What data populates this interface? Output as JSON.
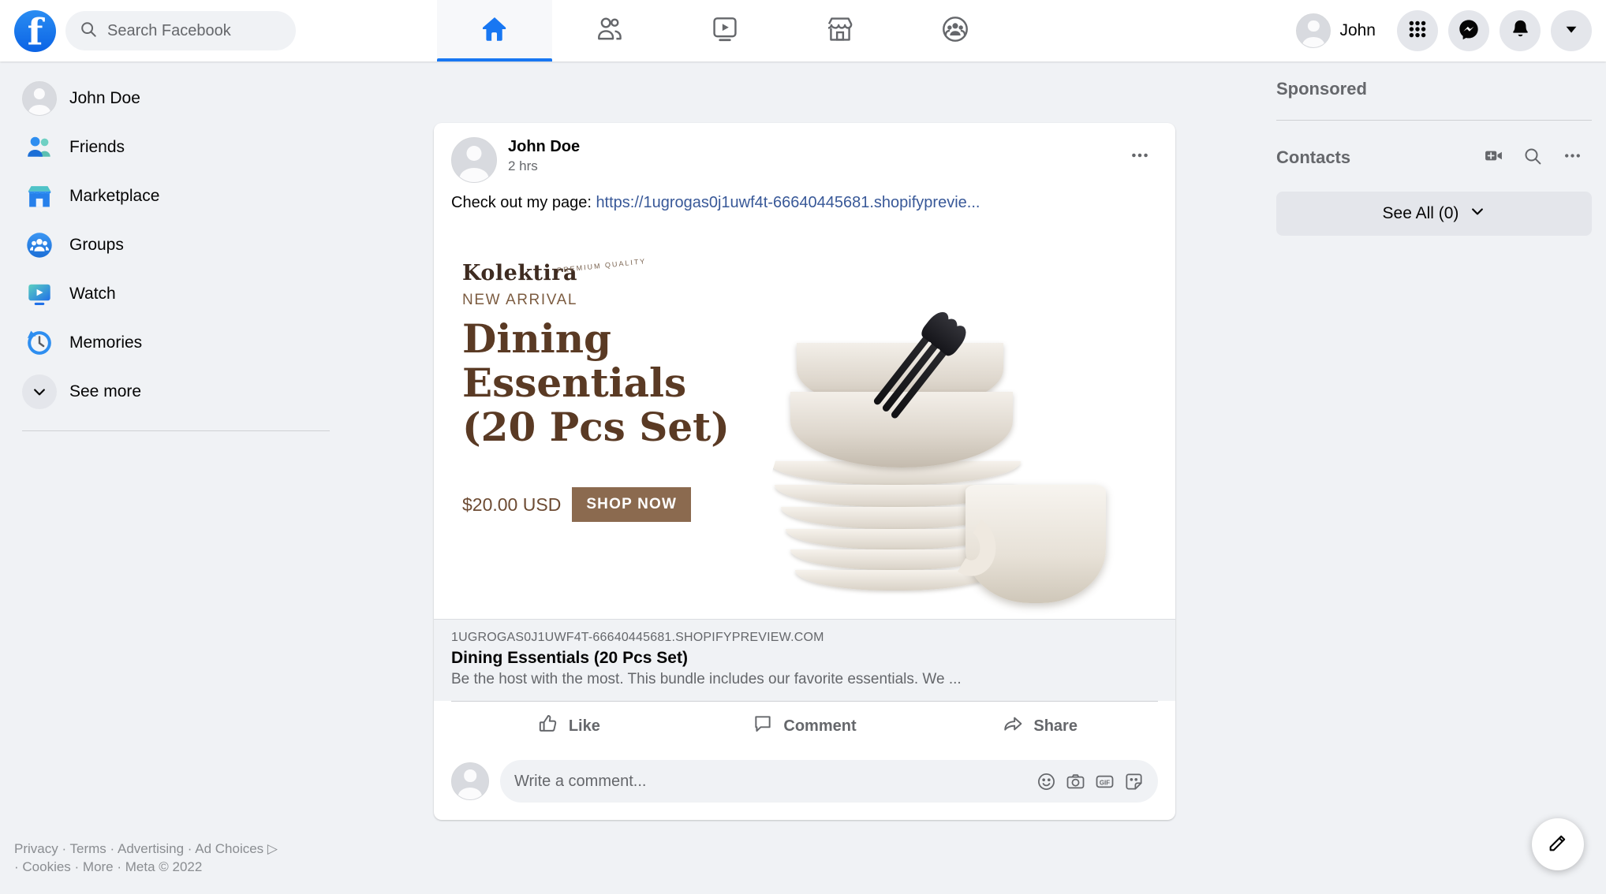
{
  "topbar": {
    "logo_alt": "facebook-logo",
    "search_placeholder": "Search Facebook",
    "nav": [
      {
        "name": "home",
        "icon": "home-icon",
        "active": true
      },
      {
        "name": "friends",
        "icon": "friends-icon",
        "active": false
      },
      {
        "name": "watch",
        "icon": "watch-icon",
        "active": false
      },
      {
        "name": "marketplace",
        "icon": "marketplace-icon",
        "active": false
      },
      {
        "name": "groups",
        "icon": "groups-icon",
        "active": false
      }
    ],
    "profile_name": "John",
    "buttons": [
      {
        "name": "menu-grid",
        "icon": "grid-icon"
      },
      {
        "name": "messenger",
        "icon": "messenger-icon"
      },
      {
        "name": "notifications",
        "icon": "bell-icon"
      },
      {
        "name": "account-dropdown",
        "icon": "caret-down-icon"
      }
    ]
  },
  "sidebar": {
    "items": [
      {
        "label": "John Doe",
        "icon": "avatar-icon"
      },
      {
        "label": "Friends",
        "icon": "friends-color-icon"
      },
      {
        "label": "Marketplace",
        "icon": "marketplace-color-icon"
      },
      {
        "label": "Groups",
        "icon": "groups-color-icon"
      },
      {
        "label": "Watch",
        "icon": "watch-color-icon"
      },
      {
        "label": "Memories",
        "icon": "memories-clock-icon"
      },
      {
        "label": "See more",
        "icon": "chevron-down-icon"
      }
    ]
  },
  "footer": {
    "line1": "Privacy · Terms · Advertising · Ad Choices",
    "adchoices_icon": "adchoices-icon",
    "line2": "· Cookies · More · Meta © 2022"
  },
  "post": {
    "author": "John Doe",
    "time": "2 hrs",
    "more_icon": "ellipsis-icon",
    "text_prefix": "Check out my page: ",
    "link_text": "https://1ugrogas0j1uwf4t-66640445681.shopifyprevie...",
    "ad": {
      "brand": "Kolektira",
      "brand_arc": "PREMIUM QUALITY",
      "eyebrow": "NEW ARRIVAL",
      "title_line1": "Dining",
      "title_line2": "Essentials",
      "title_line3": "(20 Pcs Set)",
      "price": "$20.00 USD",
      "cta": "SHOP NOW"
    },
    "link_domain": "1UGROGAS0J1UWF4T-66640445681.SHOPIFYPREVIEW.COM",
    "link_title": "Dining Essentials (20 Pcs Set)",
    "link_desc": "Be the host with the most. This bundle includes our favorite essentials. We ...",
    "actions": [
      {
        "label": "Like",
        "icon": "thumbs-up-icon"
      },
      {
        "label": "Comment",
        "icon": "comment-bubble-icon"
      },
      {
        "label": "Share",
        "icon": "share-arrow-icon"
      }
    ],
    "comment_placeholder": "Write a comment...",
    "comment_icons": [
      {
        "name": "emoji-icon"
      },
      {
        "name": "camera-icon"
      },
      {
        "name": "gif-icon"
      },
      {
        "name": "sticker-icon"
      }
    ]
  },
  "right": {
    "sponsored_title": "Sponsored",
    "contacts_title": "Contacts",
    "contacts_icons": [
      {
        "name": "video-add-icon"
      },
      {
        "name": "search-icon"
      },
      {
        "name": "ellipsis-icon"
      }
    ],
    "see_all_label": "See All (0)",
    "see_all_caret": "chevron-down-icon"
  },
  "fab": {
    "icon": "compose-pencil-icon"
  }
}
